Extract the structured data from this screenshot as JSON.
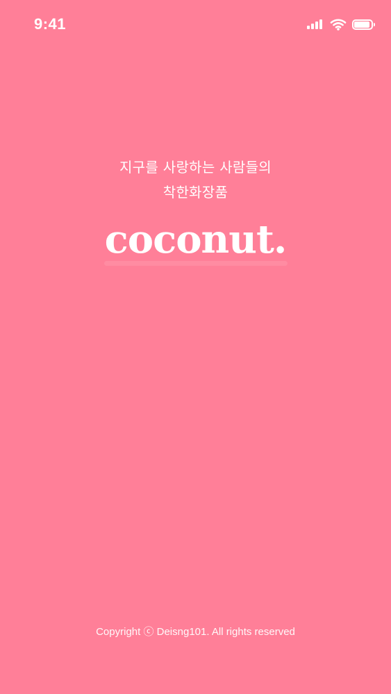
{
  "status_bar": {
    "time": "9:41",
    "icons": [
      "signal-icon",
      "wifi-icon",
      "battery-icon"
    ]
  },
  "brand": {
    "tagline_line1": "지구를 사랑하는 사람들의",
    "tagline_line2": "착한화장품",
    "logo": "coconut."
  },
  "footer": {
    "copyright": "Copyright ⓒ Deisng101. All rights reserved"
  },
  "colors": {
    "background": "#ff7f98",
    "foreground": "#ffffff"
  }
}
